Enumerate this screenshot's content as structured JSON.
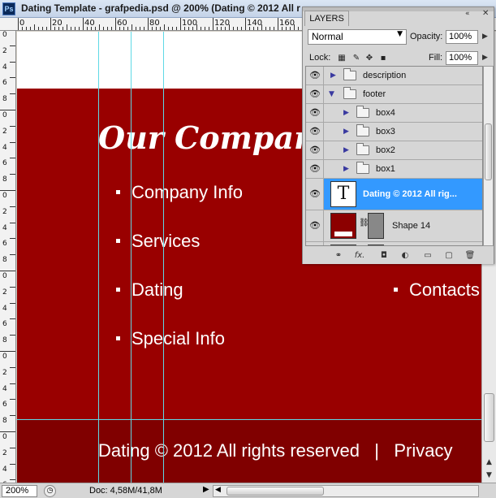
{
  "window": {
    "app_badge": "Ps",
    "title": "Dating Template - grafpedia.psd @ 200% (Dating © 2012 All r"
  },
  "rulers": {
    "top_labels": [
      "0",
      "20",
      "40",
      "60",
      "80",
      "100",
      "120",
      "140",
      "160"
    ],
    "left_labels": [
      "0",
      "2",
      "4",
      "6",
      "8",
      "0",
      "2",
      "4",
      "6",
      "8",
      "0",
      "2",
      "4",
      "6",
      "8",
      "0",
      "2",
      "4",
      "6",
      "8",
      "0",
      "2",
      "4",
      "6",
      "8",
      "0",
      "2",
      "4",
      "6"
    ]
  },
  "canvas": {
    "colors": {
      "main_background": "#990000",
      "footer_background": "#800000",
      "guide": "#5fd9e6"
    },
    "site_title": "Our Company",
    "menu_left": [
      "Company Info",
      "Services",
      "Dating",
      "Special Info"
    ],
    "menu_right": [
      "Contacts"
    ],
    "footer_text": "Dating © 2012 All rights reserved   |   Privacy"
  },
  "statusbar": {
    "zoom": "200%",
    "doc_size": "Doc: 4,58M/41,8M",
    "arrow": "▶"
  },
  "layers_panel": {
    "tab_label": "LAYERS",
    "collapse_icon": "«",
    "close_icon": "✕",
    "blend_mode": "Normal",
    "opacity_label": "Opacity:",
    "opacity_value": "100%",
    "lock_label": "Lock:",
    "fill_label": "Fill:",
    "fill_value": "100%",
    "layers": [
      {
        "name": "description",
        "type": "group",
        "visible": true,
        "expanded": false,
        "depth": 0
      },
      {
        "name": "footer",
        "type": "group",
        "visible": true,
        "expanded": true,
        "depth": 0
      },
      {
        "name": "box4",
        "type": "group",
        "visible": true,
        "expanded": false,
        "depth": 1
      },
      {
        "name": "box3",
        "type": "group",
        "visible": true,
        "expanded": false,
        "depth": 1
      },
      {
        "name": "box2",
        "type": "group",
        "visible": true,
        "expanded": false,
        "depth": 1
      },
      {
        "name": "box1",
        "type": "group",
        "visible": true,
        "expanded": false,
        "depth": 1
      },
      {
        "name": "Dating © 2012 All rig...",
        "type": "text",
        "visible": true,
        "selected": true,
        "thumb": "T"
      },
      {
        "name": "Shape 14",
        "type": "shape",
        "visible": true
      }
    ],
    "bottom_icons": [
      "link-layers-icon",
      "fx-icon",
      "mask-icon",
      "adjustment-icon",
      "new-group-icon",
      "new-layer-icon",
      "trash-icon"
    ],
    "bottom_glyphs": [
      "⚭",
      "fx.",
      "◘",
      "◐",
      "▭",
      "▢",
      "🗑"
    ]
  }
}
